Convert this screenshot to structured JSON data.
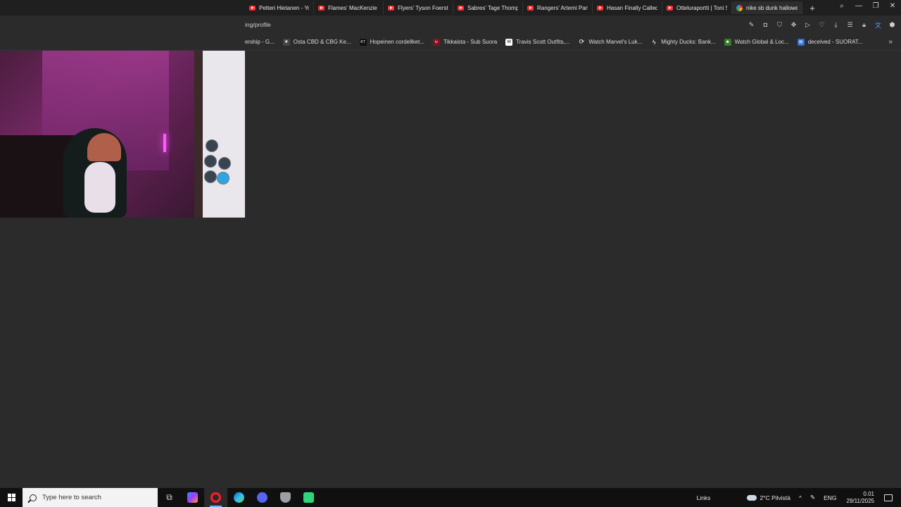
{
  "browser": {
    "tabs": [
      {
        "title": "Petteri Hietanen - You",
        "favicon": "youtube-icon",
        "active": false
      },
      {
        "title": "Flames' MacKenzie We",
        "favicon": "youtube-icon",
        "active": false
      },
      {
        "title": "Flyers' Tyson Foerster /",
        "favicon": "youtube-icon",
        "active": false
      },
      {
        "title": "Sabres' Tage Thompso",
        "favicon": "youtube-icon",
        "active": false
      },
      {
        "title": "Rangers' Artemi Panar",
        "favicon": "youtube-icon",
        "active": false
      },
      {
        "title": "Hasan Finally Called N",
        "favicon": "youtube-icon",
        "active": false
      },
      {
        "title": "Otteluraportti | Toni Sl",
        "favicon": "youtube-icon",
        "active": false
      },
      {
        "title": "nike sb dunk hallowe",
        "favicon": "google-icon",
        "active": true
      }
    ],
    "new_tab_label": "+",
    "url": "ing/profile",
    "bookmarks": [
      {
        "label": "ership - G...",
        "icon": ""
      },
      {
        "label": "Osta CBD & CBG Ke...",
        "icon": "leaf-icon"
      },
      {
        "label": "Hopeinen cordellket...",
        "icon": "KT"
      },
      {
        "label": "Tikkaista - Sub Suora",
        "icon": "tv"
      },
      {
        "label": "Travis Scott Outfits,...",
        "icon": "W"
      },
      {
        "label": "Watch Marvel's Luk...",
        "icon": "globe-icon"
      },
      {
        "label": "Mighty Ducks: Bank...",
        "icon": "bolt-icon"
      },
      {
        "label": "Watch Global & Loc...",
        "icon": "alien-icon"
      },
      {
        "label": "deceived - SUORAT...",
        "icon": "page-icon"
      }
    ]
  },
  "taskbar": {
    "search_placeholder": "Type here to search",
    "links_label": "Links",
    "weather": "2°C  Pilvistä",
    "language": "ENG",
    "time": "0.01",
    "date": "29/11/2025"
  },
  "colors": {
    "page_background": "#2b2b2b",
    "taskbar_background": "#101010",
    "youtube_red": "#ff2d2d"
  }
}
